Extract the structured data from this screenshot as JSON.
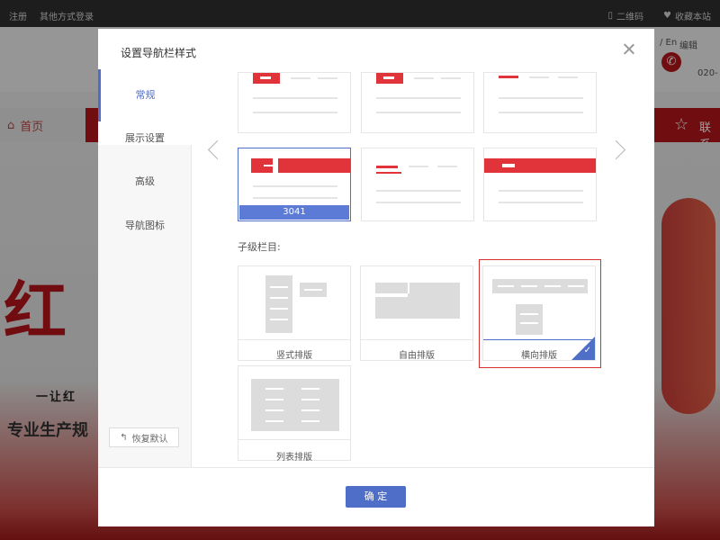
{
  "topbar": {
    "register": "注册",
    "other_login": "其他方式登录",
    "qrcode": "二维码",
    "favorite": "收藏本站"
  },
  "site": {
    "home": "首页",
    "nav_right": "联系",
    "lang": "/ En",
    "edit": "编辑",
    "tel": "020-",
    "calligraphy": "红",
    "slogan": "一让红",
    "tagline": "专业生产规"
  },
  "dialog": {
    "title": "设置导航栏样式",
    "sidebar": [
      {
        "label": "常规",
        "active": true
      },
      {
        "label": "展示设置",
        "active": false
      },
      {
        "label": "高级",
        "active": false
      },
      {
        "label": "导航图标",
        "active": false
      }
    ],
    "reset_label": "恢复默认",
    "selected_style_id": "3041",
    "sub_section_label": "子级栏目:",
    "sub_styles": [
      {
        "label": "竖式排版",
        "selected": false
      },
      {
        "label": "自由排版",
        "selected": false
      },
      {
        "label": "横向排版",
        "selected": true
      },
      {
        "label": "列表排版",
        "selected": false
      }
    ],
    "confirm_label": "确 定",
    "colors": {
      "accent": "#4f6ec8",
      "red": "#e0333a",
      "selected_frame": "#d63031"
    }
  }
}
